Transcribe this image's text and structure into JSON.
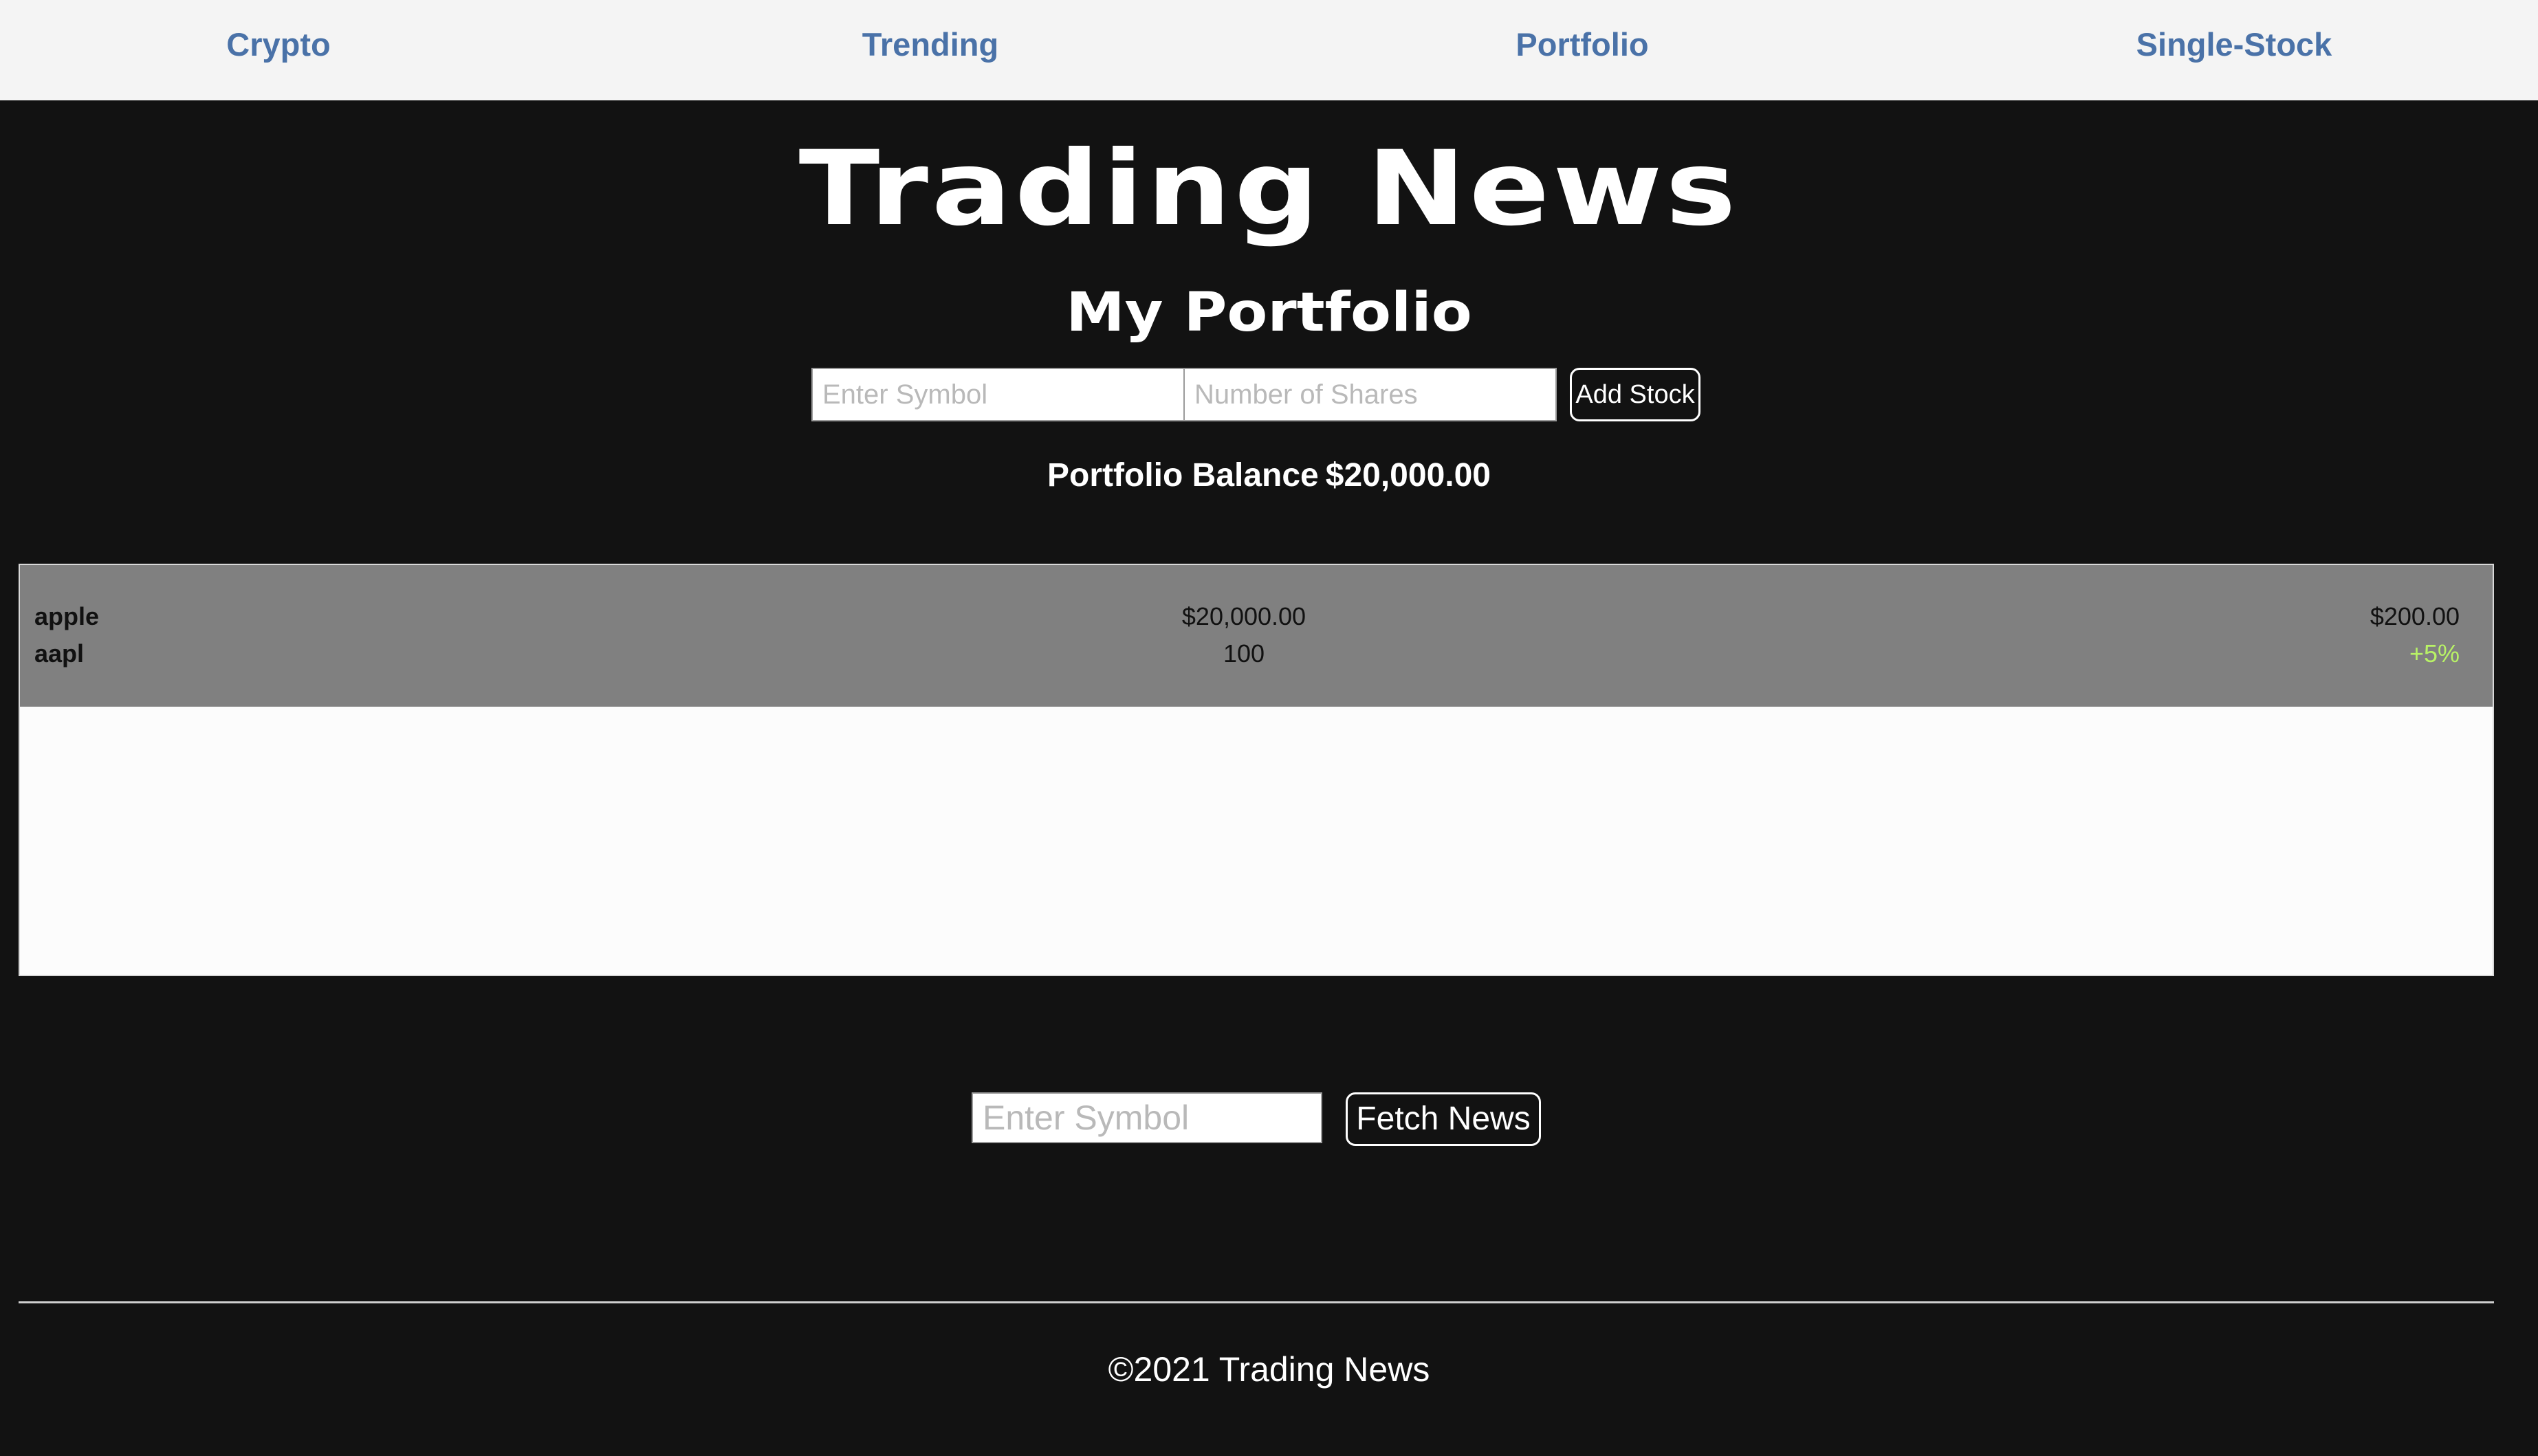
{
  "nav": {
    "items": [
      {
        "label": "Crypto"
      },
      {
        "label": "Trending"
      },
      {
        "label": "Portfolio"
      },
      {
        "label": "Single-Stock"
      }
    ]
  },
  "header": {
    "title": "Trading News",
    "subtitle": "My Portfolio"
  },
  "add_form": {
    "symbol_placeholder": "Enter Symbol",
    "shares_placeholder": "Number of Shares",
    "add_button_label": "Add Stock"
  },
  "balance": {
    "label": "Portfolio Balance",
    "value": "$20,000.00"
  },
  "holdings": [
    {
      "name": "apple",
      "ticker": "aapl",
      "value": "$20,000.00",
      "shares": "100",
      "price": "$200.00",
      "change": "+5%"
    }
  ],
  "news_form": {
    "symbol_placeholder": "Enter Symbol",
    "button_label": "Fetch News"
  },
  "footer": {
    "text": "©2021 Trading News"
  },
  "colors": {
    "background": "#121212",
    "nav_background": "#f4f4f4",
    "nav_link": "#4a72a8",
    "row_background": "#808080",
    "positive_change": "#b8f266"
  }
}
